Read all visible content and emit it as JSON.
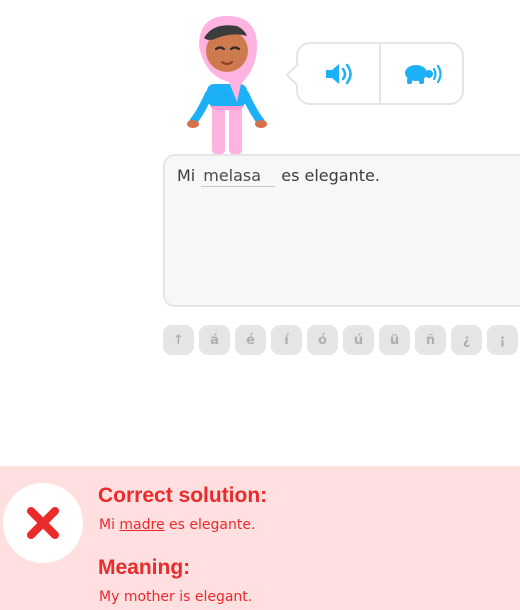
{
  "answer": {
    "prefix": "Mi",
    "typed_word": "melasa",
    "suffix": "es elegante."
  },
  "accent_keys": [
    "↑",
    "á",
    "é",
    "í",
    "ó",
    "ú",
    "ü",
    "ñ",
    "¿",
    "¡"
  ],
  "feedback": {
    "status": "incorrect",
    "correct_title": "Correct solution:",
    "correct_prefix": "Mi",
    "correct_word": "madre",
    "correct_suffix": "es elegante.",
    "meaning_title": "Meaning:",
    "meaning_text": "My mother is elegant."
  },
  "colors": {
    "accent_blue": "#1cb0f6",
    "error_red": "#ea2b2b",
    "feedback_bg": "#ffdfe0"
  },
  "icons": [
    "speaker-icon",
    "turtle-slow-speaker-icon",
    "x-mark-icon"
  ]
}
